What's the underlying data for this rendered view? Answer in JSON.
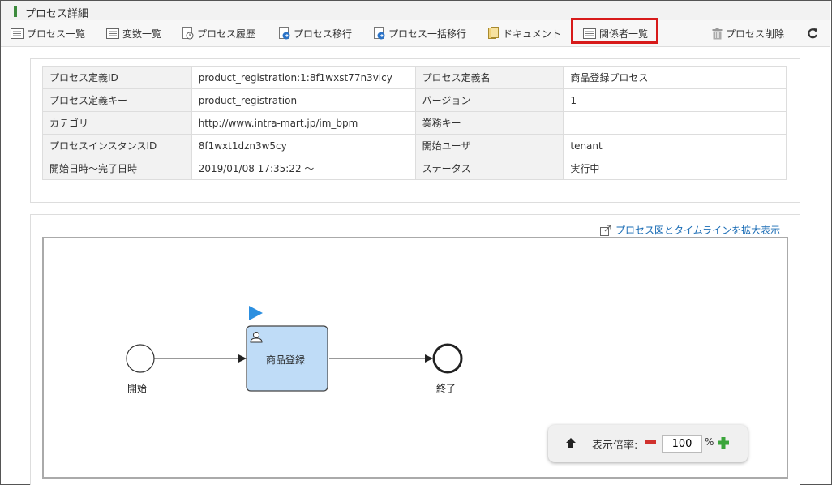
{
  "title": "プロセス詳細",
  "toolbar": {
    "process_list": "プロセス一覧",
    "variable_list": "変数一覧",
    "process_history": "プロセス履歴",
    "process_migrate": "プロセス移行",
    "process_bulk_migrate": "プロセス一括移行",
    "document": "ドキュメント",
    "participants_list": "関係者一覧",
    "process_delete": "プロセス削除"
  },
  "info": {
    "rows": [
      {
        "k1": "プロセス定義ID",
        "v1": "product_registration:1:8f1wxst77n3vicy",
        "k2": "プロセス定義名",
        "v2": "商品登録プロセス"
      },
      {
        "k1": "プロセス定義キー",
        "v1": "product_registration",
        "k2": "バージョン",
        "v2": "1"
      },
      {
        "k1": "カテゴリ",
        "v1": "http://www.intra-mart.jp/im_bpm",
        "k2": "業務キー",
        "v2": ""
      },
      {
        "k1": "プロセスインスタンスID",
        "v1": "8f1wxt1dzn3w5cy",
        "k2": "開始ユーザ",
        "v2": "tenant"
      },
      {
        "k1": "開始日時～完了日時",
        "v1": "2019/01/08 17:35:22 ～",
        "k2": "ステータス",
        "v2": "実行中"
      }
    ]
  },
  "diagram": {
    "expand_link": "プロセス図とタイムラインを拡大表示",
    "start_label": "開始",
    "task_label": "商品登録",
    "end_label": "終了"
  },
  "zoom": {
    "label": "表示倍率:",
    "value": "100",
    "unit": "%"
  },
  "colors": {
    "highlight": "#d71a1a",
    "task_fill": "#bfdcf7",
    "link": "#1a6cb5"
  }
}
